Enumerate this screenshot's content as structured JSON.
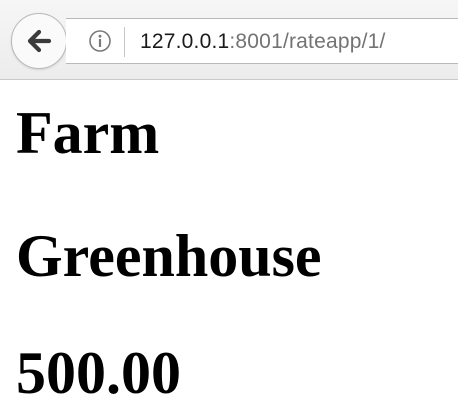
{
  "browser": {
    "url_host": "127.0.0.1",
    "url_rest": ":8001/rateapp/1/"
  },
  "page": {
    "headings": [
      "Farm",
      "Greenhouse",
      "500.00"
    ]
  },
  "colors": {
    "url_host": "#1b1b1b",
    "url_rest": "#737373",
    "text": "#000000"
  },
  "icons": {
    "back": "back-arrow-icon",
    "info": "info-icon"
  }
}
